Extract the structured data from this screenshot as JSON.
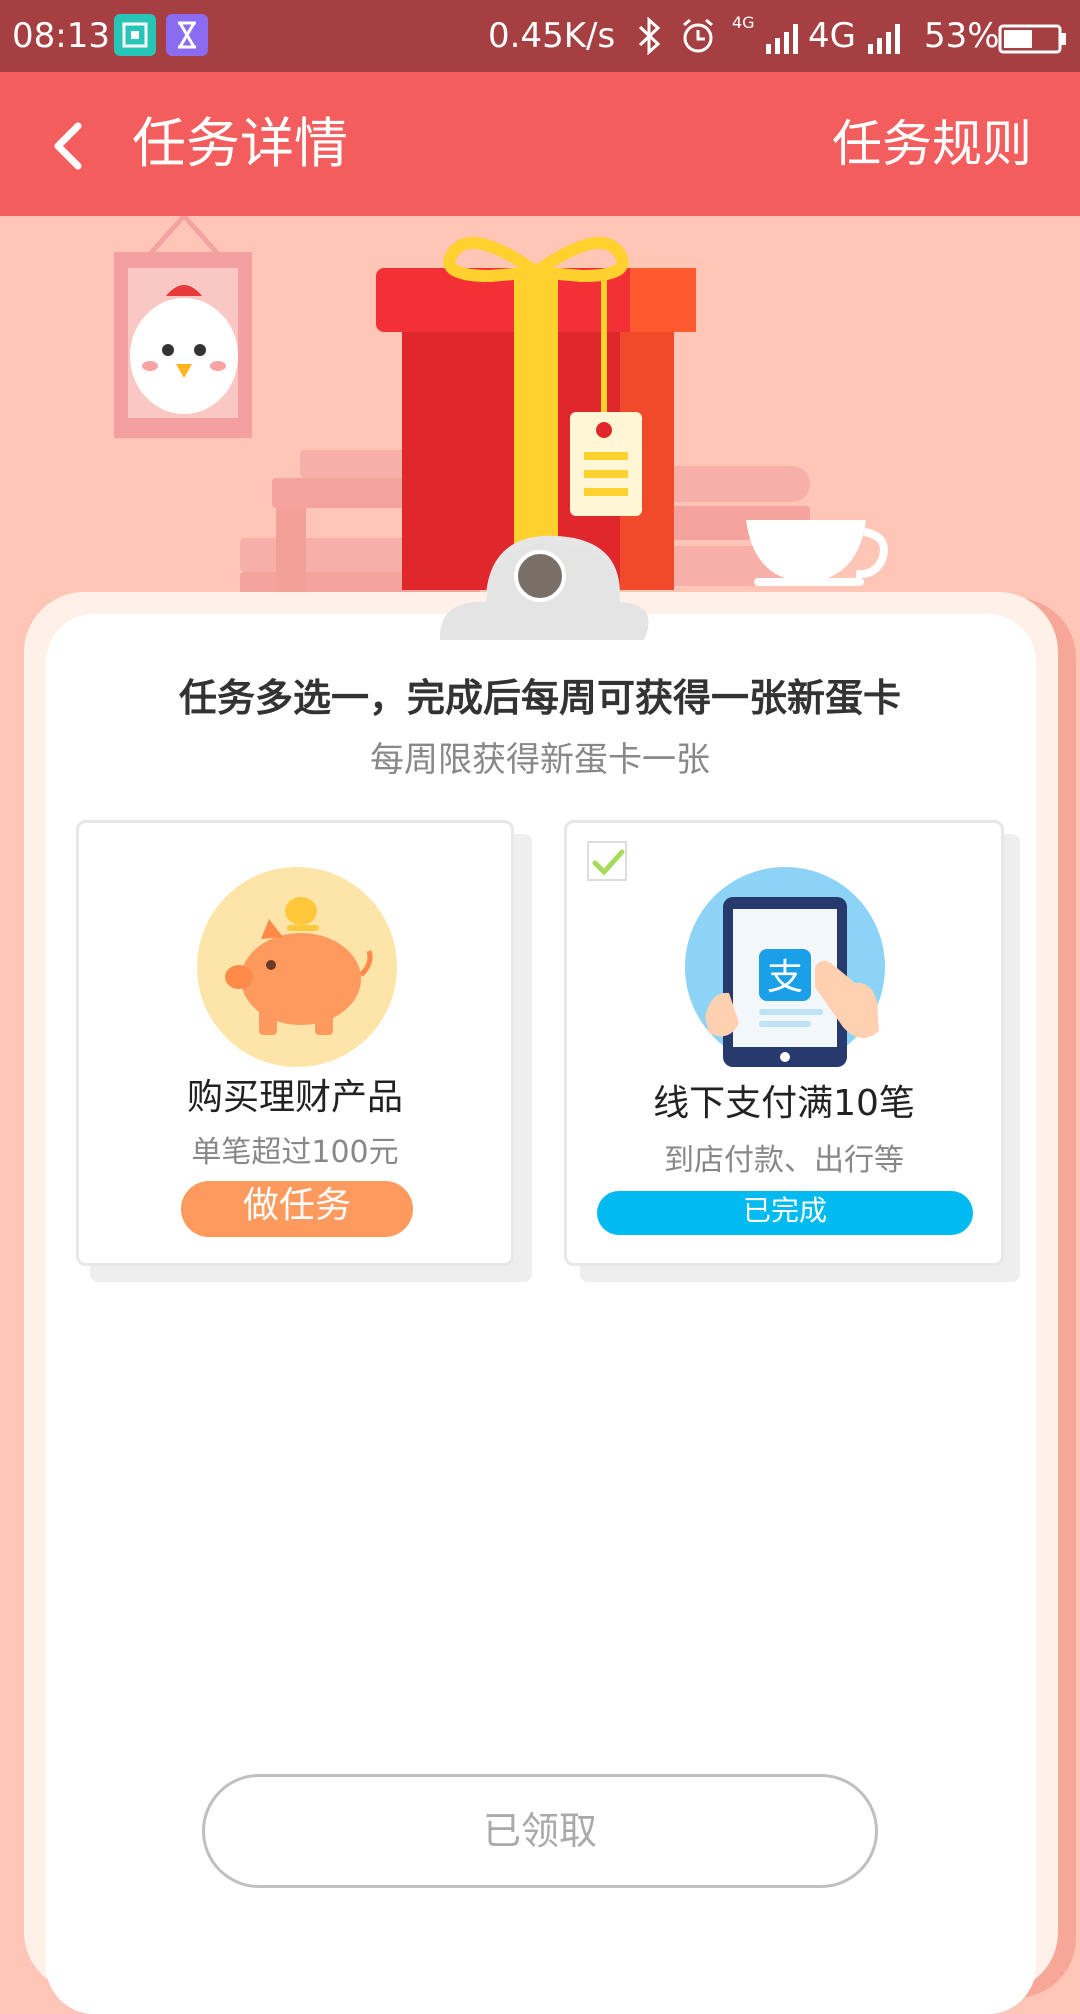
{
  "status_bar": {
    "time": "08:13",
    "speed": "0.45K/s",
    "network_small": "4G",
    "network": "4G",
    "battery": "53%",
    "app_icon_1": "screenshot-app-icon",
    "app_icon_2": "hourglass-app-icon",
    "bluetooth_icon": "bluetooth-icon",
    "alarm_icon": "alarm-icon",
    "signal_icon": "signal-icon",
    "battery_level": 0.53
  },
  "header": {
    "back_icon": "chevron-left-icon",
    "title": "任务详情",
    "rules_label": "任务规则",
    "color": "#f35d5d"
  },
  "card": {
    "headline": "任务多选一，完成后每周可获得一张新蛋卡",
    "subline": "每周限获得新蛋卡一张",
    "tasks": [
      {
        "icon": "piggy-bank-icon",
        "title": "购买理财产品",
        "desc": "单笔超过100元",
        "button": "做任务",
        "button_color": "#ff9a5e",
        "checked": false
      },
      {
        "icon": "alipay-tablet-icon",
        "title": "线下支付满10笔",
        "desc": "到店付款、出行等",
        "button": "已完成",
        "button_color": "#00baf0",
        "checked": true
      }
    ],
    "claim_button": "已领取"
  }
}
